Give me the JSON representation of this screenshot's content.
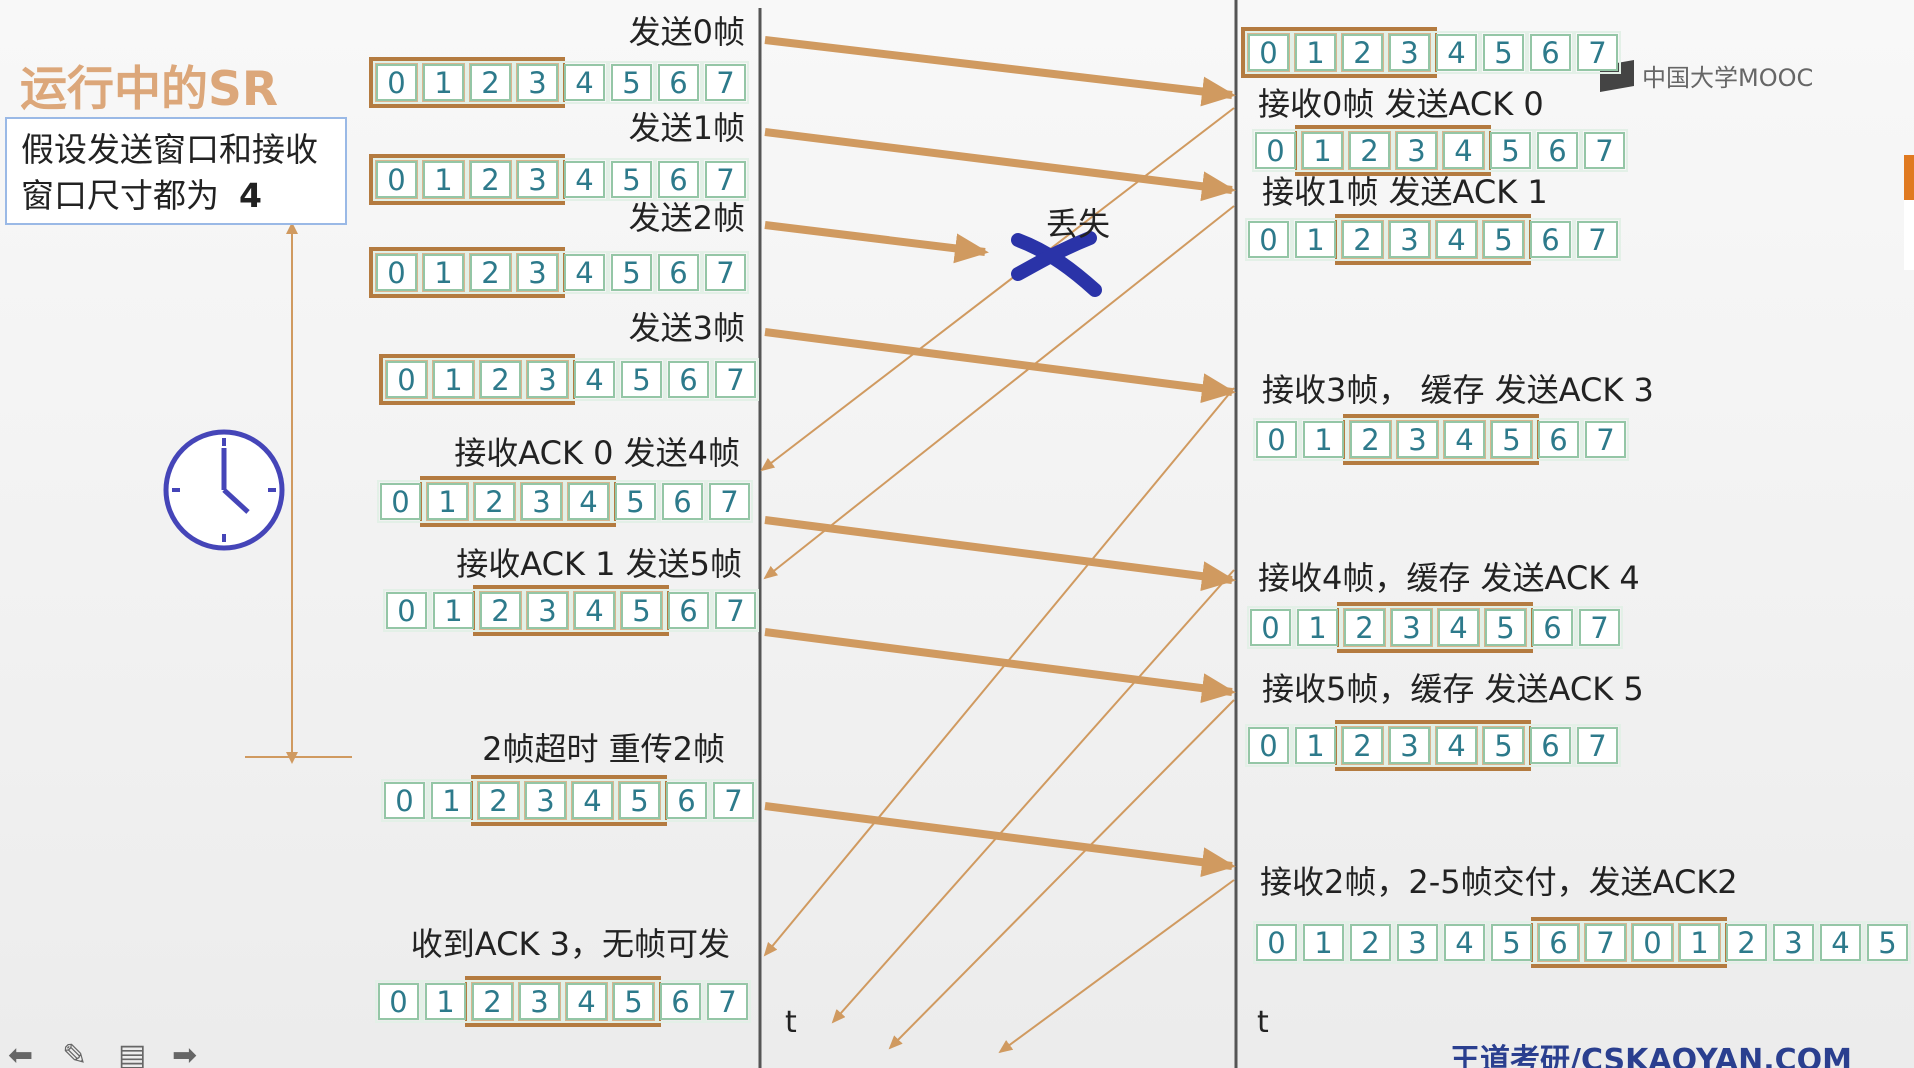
{
  "title": "运行中的SR",
  "note": {
    "text": "假设发送窗口和接收窗口尺寸都为",
    "n": "4"
  },
  "watermark": "中国大学MOOC",
  "brand": "王道考研/CSKAOYAN.COM",
  "lost_label": "丢失",
  "axis_t": "t",
  "nav_icons": [
    "back-arrow-icon",
    "pen-icon",
    "menu-icon",
    "forward-arrow-icon"
  ],
  "colors": {
    "window": "#b47b40",
    "cell_border": "#94c6a6",
    "cell_text": "#2d7a8b",
    "arrow": "#d09a60",
    "title": "#dca77a",
    "lost_x": "#2a33a8"
  },
  "sender": [
    {
      "label": "发送0帧",
      "cells": [
        "0",
        "1",
        "2",
        "3",
        "4",
        "5",
        "6",
        "7"
      ],
      "window_start": 0,
      "window_len": 4
    },
    {
      "label": "发送1帧",
      "cells": [
        "0",
        "1",
        "2",
        "3",
        "4",
        "5",
        "6",
        "7"
      ],
      "window_start": 0,
      "window_len": 4
    },
    {
      "label": "发送2帧",
      "cells": [
        "0",
        "1",
        "2",
        "3",
        "4",
        "5",
        "6",
        "7"
      ],
      "window_start": 0,
      "window_len": 4
    },
    {
      "label": "发送3帧",
      "cells": [
        "0",
        "1",
        "2",
        "3",
        "4",
        "5",
        "6",
        "7"
      ],
      "window_start": 0,
      "window_len": 4
    },
    {
      "label": "接收ACK 0  发送4帧",
      "cells": [
        "0",
        "1",
        "2",
        "3",
        "4",
        "5",
        "6",
        "7"
      ],
      "window_start": 1,
      "window_len": 4
    },
    {
      "label": "接收ACK 1  发送5帧",
      "cells": [
        "0",
        "1",
        "2",
        "3",
        "4",
        "5",
        "6",
        "7"
      ],
      "window_start": 2,
      "window_len": 4
    },
    {
      "label": "2帧超时   重传2帧",
      "cells": [
        "0",
        "1",
        "2",
        "3",
        "4",
        "5",
        "6",
        "7"
      ],
      "window_start": 2,
      "window_len": 4
    },
    {
      "label": "收到ACK 3，无帧可发",
      "cells": [
        "0",
        "1",
        "2",
        "3",
        "4",
        "5",
        "6",
        "7"
      ],
      "window_start": 2,
      "window_len": 4
    }
  ],
  "receiver": [
    {
      "label": "",
      "cells": [
        "0",
        "1",
        "2",
        "3",
        "4",
        "5",
        "6",
        "7"
      ],
      "window_start": 0,
      "window_len": 4
    },
    {
      "label": "接收0帧 发送ACK 0",
      "cells": [
        "0",
        "1",
        "2",
        "3",
        "4",
        "5",
        "6",
        "7"
      ],
      "window_start": 1,
      "window_len": 4
    },
    {
      "label": "接收1帧 发送ACK 1",
      "cells": [
        "0",
        "1",
        "2",
        "3",
        "4",
        "5",
        "6",
        "7"
      ],
      "window_start": 2,
      "window_len": 4
    },
    {
      "label": "接收3帧，  缓存   发送ACK 3",
      "cells": [
        "0",
        "1",
        "2",
        "3",
        "4",
        "5",
        "6",
        "7"
      ],
      "window_start": 2,
      "window_len": 4
    },
    {
      "label": "接收4帧，缓存  发送ACK 4",
      "cells": [
        "0",
        "1",
        "2",
        "3",
        "4",
        "5",
        "6",
        "7"
      ],
      "window_start": 2,
      "window_len": 4
    },
    {
      "label": "接收5帧，缓存  发送ACK 5",
      "cells": [
        "0",
        "1",
        "2",
        "3",
        "4",
        "5",
        "6",
        "7"
      ],
      "window_start": 2,
      "window_len": 4
    },
    {
      "label": "接收2帧，2-5帧交付，发送ACK2",
      "cells": [
        "0",
        "1",
        "2",
        "3",
        "4",
        "5",
        "6",
        "7",
        "0",
        "1",
        "2",
        "3",
        "4",
        "5"
      ],
      "window_start": 6,
      "window_len": 4
    }
  ]
}
